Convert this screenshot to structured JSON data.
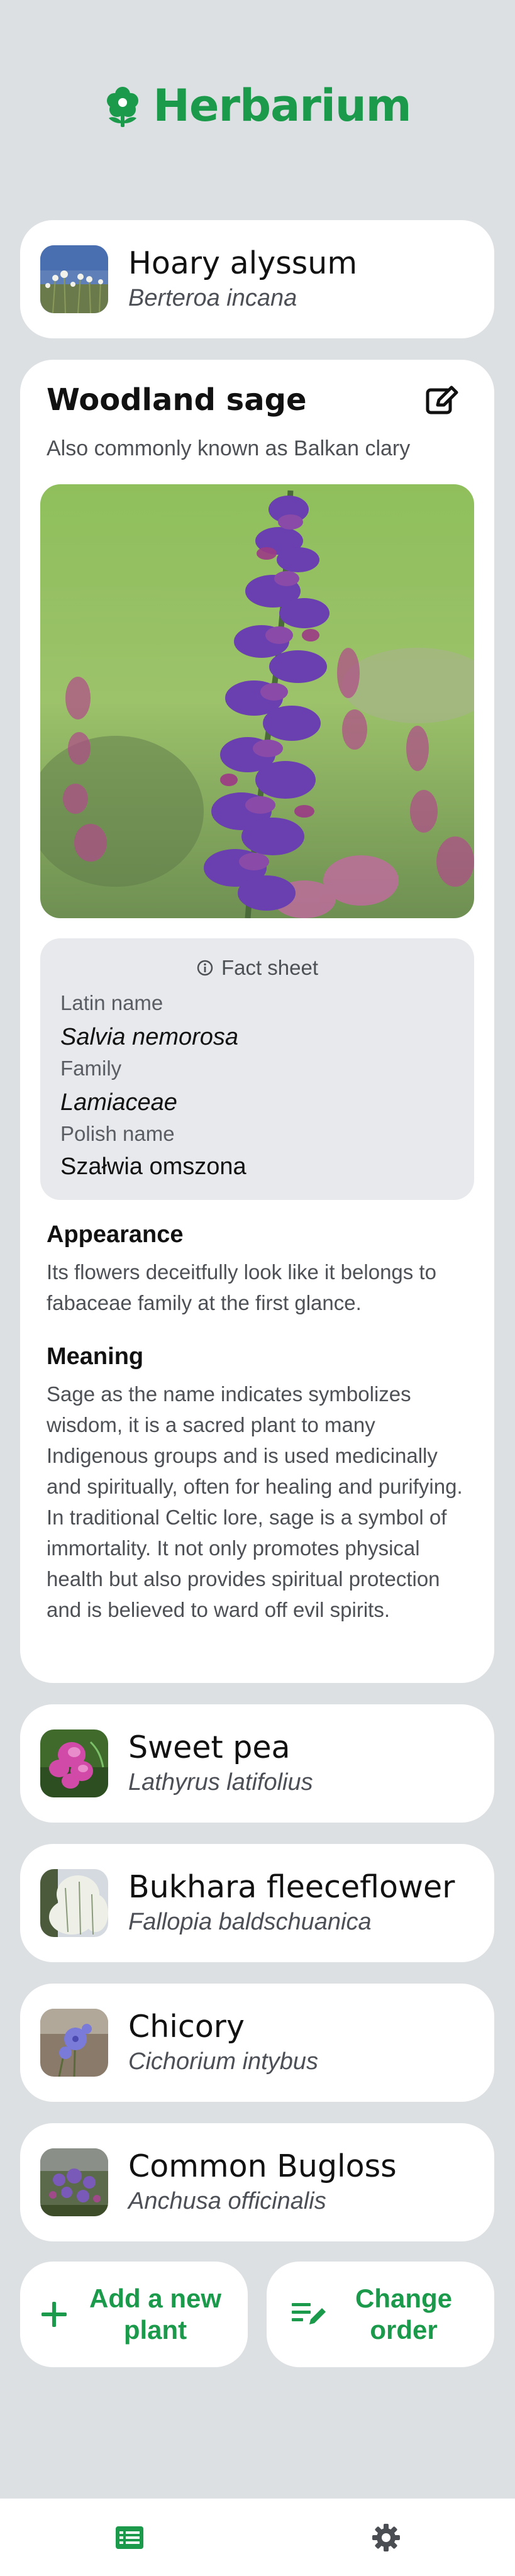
{
  "app": {
    "title": "Herbarium",
    "logo_icon": "flower-icon",
    "brand_color": "#1b9a4b"
  },
  "plants_top": [
    {
      "name": "Hoary alyssum",
      "latin": "Berteroa incana",
      "thumb_icon": "hoary-alyssum-photo"
    }
  ],
  "detail": {
    "name": "Woodland sage",
    "also_known": "Also commonly known as Balkan clary",
    "edit_icon": "edit-icon",
    "photo": "salvia-photo",
    "fact_sheet": {
      "title": "Fact sheet",
      "latin_label": "Latin name",
      "latin_value": "Salvia nemorosa",
      "family_label": "Family",
      "family_value": "Lamiaceae",
      "polish_label": "Polish name",
      "polish_value": "Szałwia omszona"
    },
    "appearance_title": "Appearance",
    "appearance_text": "Its flowers deceitfully look like it belongs to fabaceae family at the first glance.",
    "meaning_title": "Meaning",
    "meaning_text": "Sage as the name indicates symbolizes wisdom, it is a sacred plant to many Indigenous groups and is used medicinally and spiritually, often for healing and purifying. In traditional Celtic lore, sage is a symbol of immortality. It not only promotes physical health but also provides spiritual protection and is believed to ward off evil spirits."
  },
  "plants_bottom": [
    {
      "name": "Sweet pea",
      "latin": "Lathyrus latifolius"
    },
    {
      "name": "Bukhara fleeceflower",
      "latin": "Fallopia baldschuanica"
    },
    {
      "name": "Chicory",
      "latin": "Cichorium intybus"
    },
    {
      "name": "Common Bugloss",
      "latin": "Anchusa officinalis"
    }
  ],
  "actions": {
    "add_label": "Add a new plant",
    "add_icon": "plus-icon",
    "order_label": "Change order",
    "order_icon": "reorder-edit-icon"
  },
  "nav": {
    "list_icon": "list-icon",
    "settings_icon": "gear-icon"
  }
}
